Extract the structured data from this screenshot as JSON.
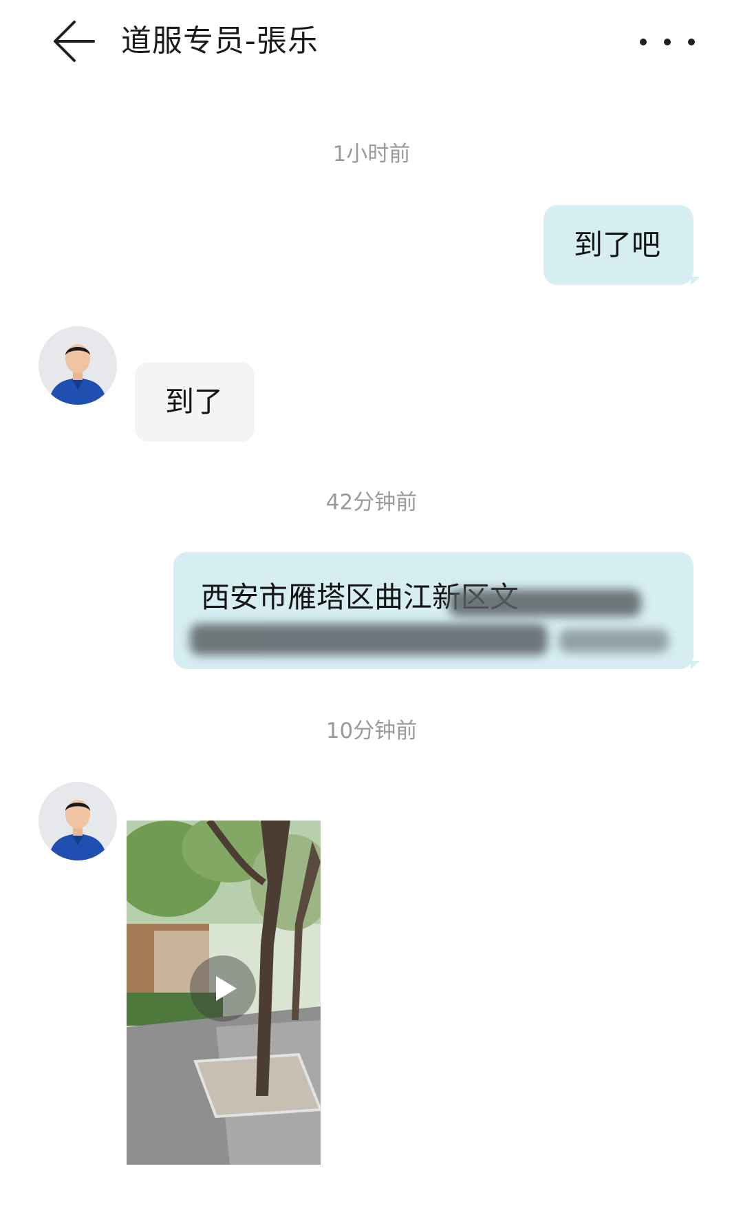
{
  "header": {
    "title": "道服专员-張乐",
    "back_icon": "arrow-left-icon",
    "more_icon": "more-horizontal-icon"
  },
  "messages": {
    "ts1": "1小时前",
    "sent1": "到了吧",
    "recv1": "到了",
    "ts2": "42分钟前",
    "sent2_visible": "西安市雁塔区曲江新区文",
    "ts3": "10分钟前",
    "video_icon": "play-icon"
  },
  "colors": {
    "sent_bubble": "#d6eef2",
    "recv_bubble": "#f4f4f4",
    "timestamp": "#9a9a9a",
    "avatar_shirt": "#1f4fb0"
  }
}
